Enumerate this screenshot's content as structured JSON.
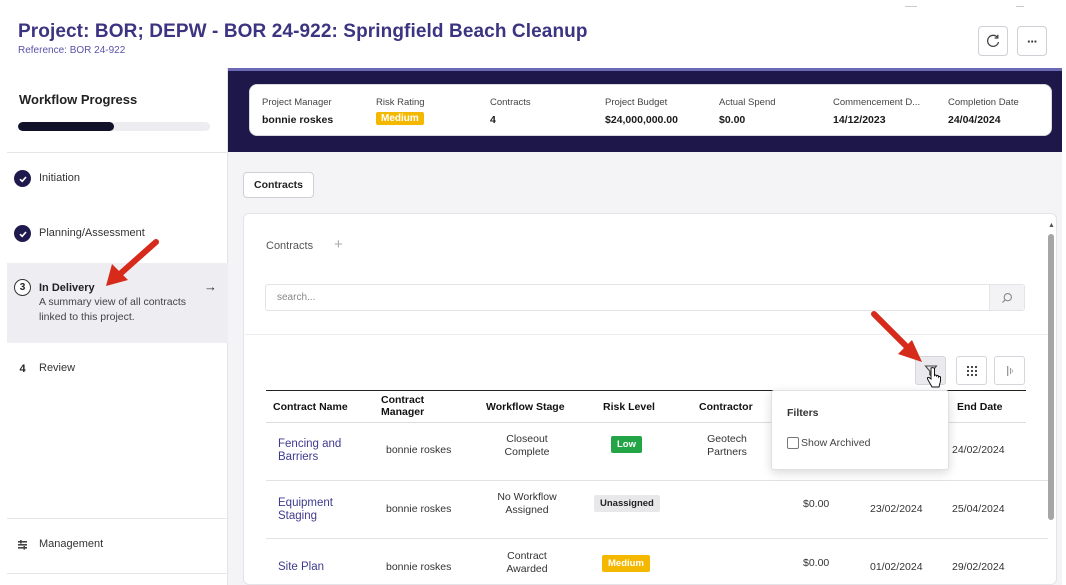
{
  "header": {
    "title": "Project: BOR; DEPW - BOR 24-922: Springfield Beach Cleanup",
    "reference": "Reference: BOR 24-922",
    "refresh_icon": "refresh-icon",
    "more_label": "···"
  },
  "sidebar": {
    "title": "Workflow Progress",
    "progress": 0.5,
    "steps": [
      {
        "label": "Initiation",
        "state": "done",
        "icon": "check-icon"
      },
      {
        "label": "Planning/Assessment",
        "state": "done",
        "icon": "check-icon"
      },
      {
        "number": "3",
        "label": "In Delivery",
        "state": "active",
        "description": "A summary view of all contracts linked to this project."
      },
      {
        "number": "4",
        "label": "Review",
        "state": "pending"
      }
    ],
    "management": {
      "label": "Management",
      "icon": "management-icon"
    }
  },
  "summary": {
    "project_manager": {
      "label": "Project Manager",
      "value": "bonnie roskes"
    },
    "risk_rating": {
      "label": "Risk Rating",
      "value": "Medium",
      "color": "#f5b800"
    },
    "contracts": {
      "label": "Contracts",
      "value": "4"
    },
    "project_budget": {
      "label": "Project Budget",
      "value": "$24,000,000.00"
    },
    "actual_spend": {
      "label": "Actual Spend",
      "value": "$0.00"
    },
    "commencement": {
      "label": "Commencement D...",
      "value": "14/12/2023"
    },
    "completion": {
      "label": "Completion Date",
      "value": "24/04/2024"
    }
  },
  "main": {
    "tab_label": "Contracts",
    "panel_title": "Contracts",
    "add_label": "+",
    "search": {
      "placeholder": "search..."
    },
    "table": {
      "headers": {
        "contract_name": "Contract Name",
        "contract_manager": "Contract Manager",
        "workflow_stage": "Workflow Stage",
        "risk_level": "Risk Level",
        "contractor": "Contractor",
        "end_date": "End Date"
      },
      "rows": [
        {
          "name": "Fencing and Barriers",
          "manager": "bonnie roskes",
          "stage": "Closeout Complete",
          "risk": "Low",
          "risk_color": "#22a447",
          "contractor": "Geotech Partners",
          "amount": "",
          "start": "",
          "end": "24/02/2024"
        },
        {
          "name": "Equipment Staging",
          "manager": "bonnie roskes",
          "stage": "No Workflow Assigned",
          "risk": "Unassigned",
          "risk_color": "#e8e8ea",
          "contractor": "",
          "amount": "$0.00",
          "start": "23/02/2024",
          "end": "25/04/2024"
        },
        {
          "name": "Site Plan",
          "manager": "bonnie roskes",
          "stage": "Contract Awarded",
          "risk": "Medium",
          "risk_color": "#f5b800",
          "contractor": "",
          "amount": "$0.00",
          "start": "01/02/2024",
          "end": "29/02/2024"
        }
      ]
    },
    "filter_popup": {
      "title": "Filters",
      "show_archived_label": "Show Archived",
      "show_archived_checked": false
    }
  },
  "colors": {
    "brand": "#3b3480",
    "banner": "#1d1849",
    "annotation": "#d62a1a"
  }
}
